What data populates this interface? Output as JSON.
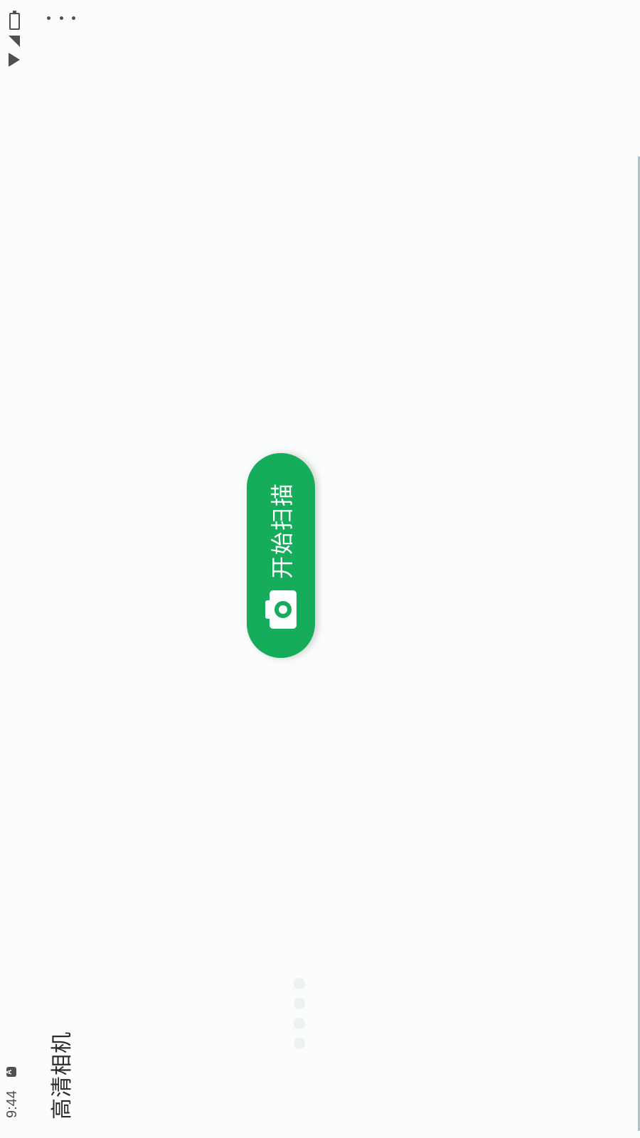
{
  "status_bar": {
    "time": "9:44",
    "notification_icon": "a-icon",
    "icons": [
      "wifi-icon",
      "signal-icon",
      "battery-icon"
    ]
  },
  "app_bar": {
    "title": "高清相机",
    "menu_icon": "more-icon"
  },
  "main": {
    "scan_button": {
      "label": "开始扫描",
      "icon": "camera-icon",
      "color": "#15ad5c"
    }
  },
  "colors": {
    "background": "#fbfcfc",
    "accent": "#15ad5c"
  }
}
